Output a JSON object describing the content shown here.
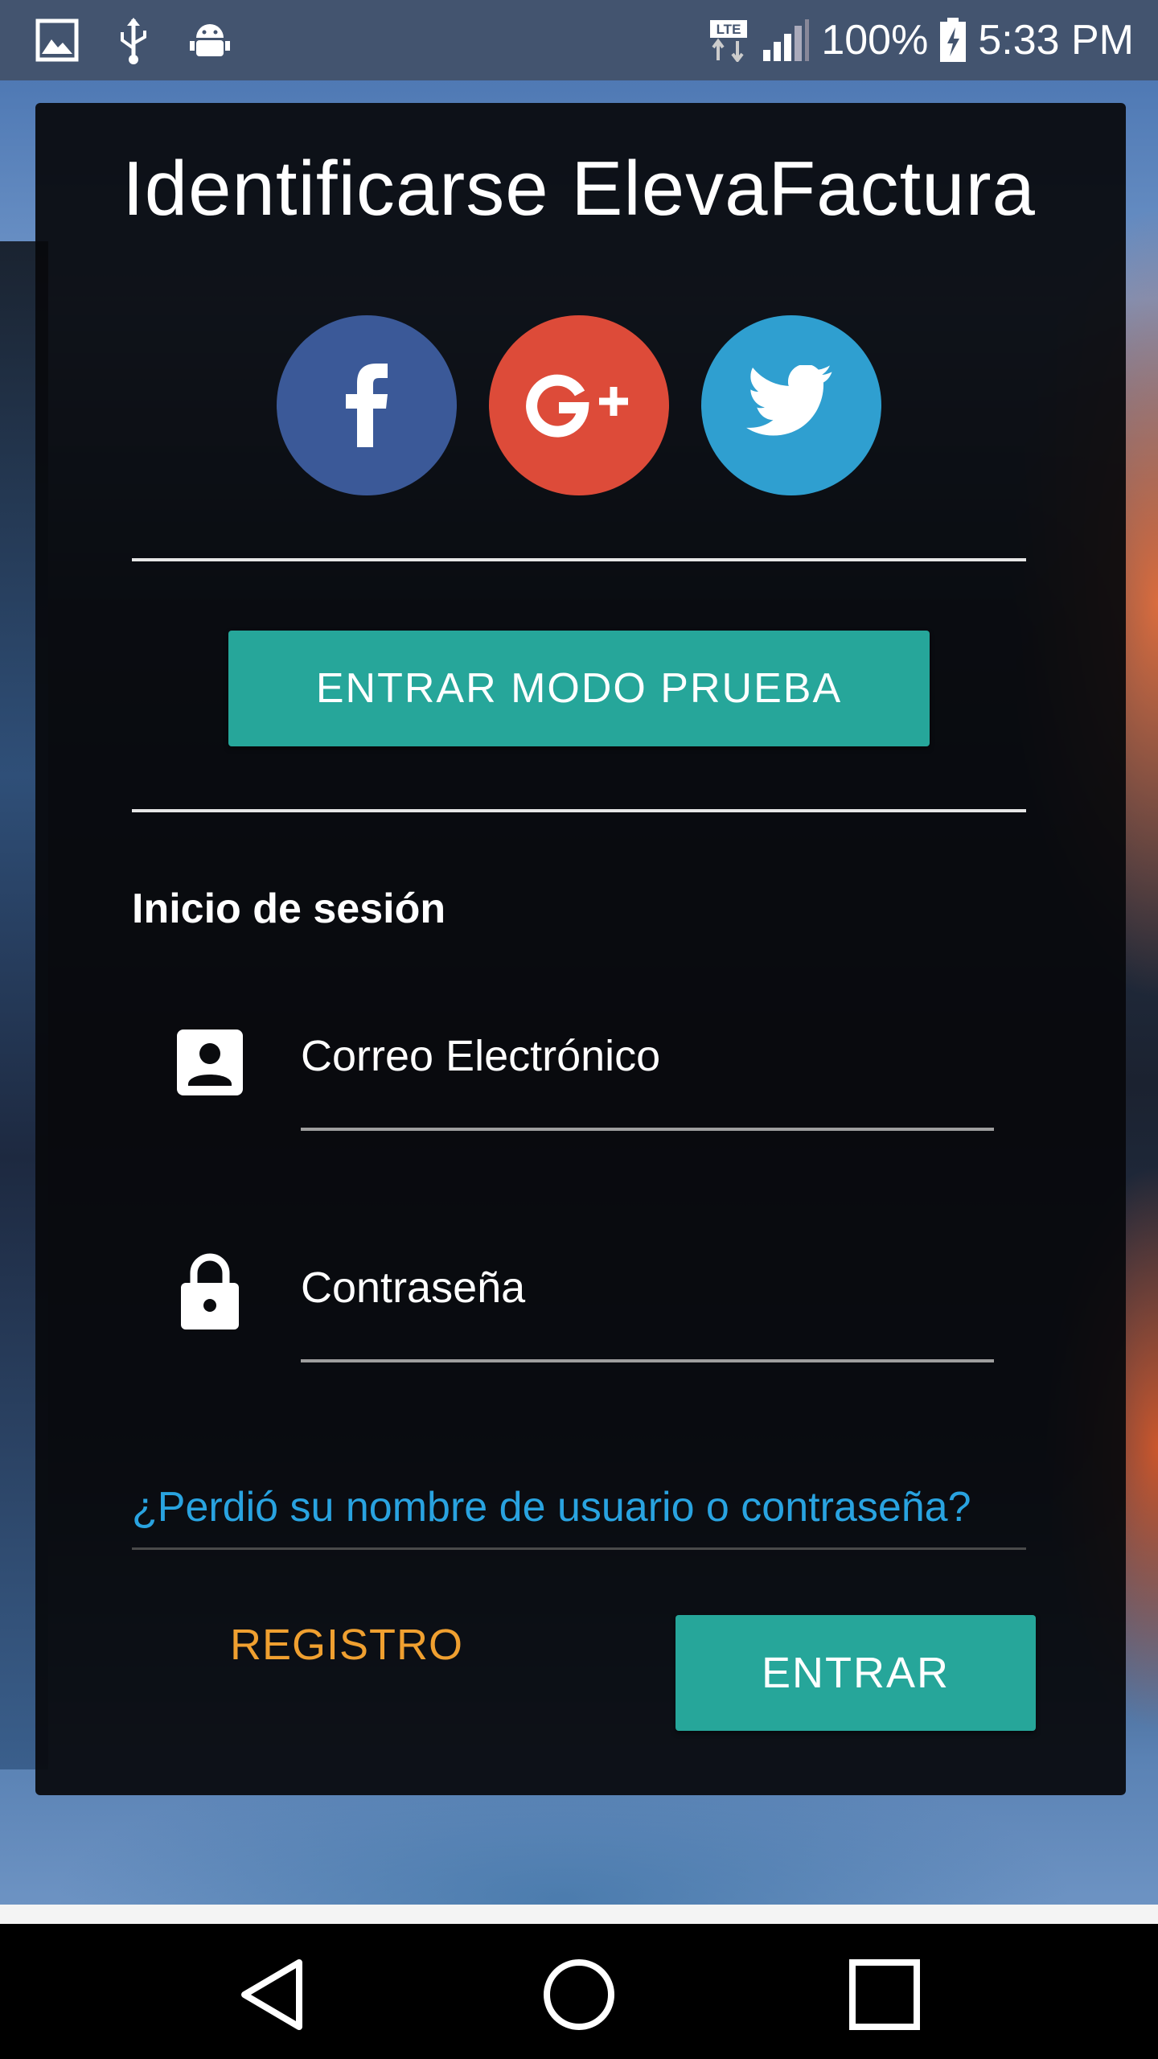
{
  "status_bar": {
    "left_icons": [
      "gallery-icon",
      "usb-icon",
      "android-debug-icon"
    ],
    "network": "LTE",
    "battery": "100%",
    "time": "5:33 PM"
  },
  "login": {
    "title": "Identificarse ElevaFactura",
    "social": [
      {
        "name": "facebook",
        "color": "#3b5998"
      },
      {
        "name": "google-plus",
        "color": "#dd4b39"
      },
      {
        "name": "twitter",
        "color": "#2f9fd0"
      }
    ],
    "trial_button": "ENTRAR MODO PRUEBA",
    "section_label": "Inicio de sesión",
    "email_placeholder": "Correo Electrónico",
    "password_placeholder": "Contraseña",
    "forgot_link": "¿Perdió su nombre de usuario o contraseña?",
    "register_button": "REGISTRO",
    "enter_button": "ENTRAR"
  },
  "colors": {
    "accent": "#26a69a",
    "link": "#29a3e0",
    "register": "#f0a030"
  },
  "nav_bar": {
    "buttons": [
      "back-icon",
      "home-icon",
      "recents-icon"
    ]
  }
}
